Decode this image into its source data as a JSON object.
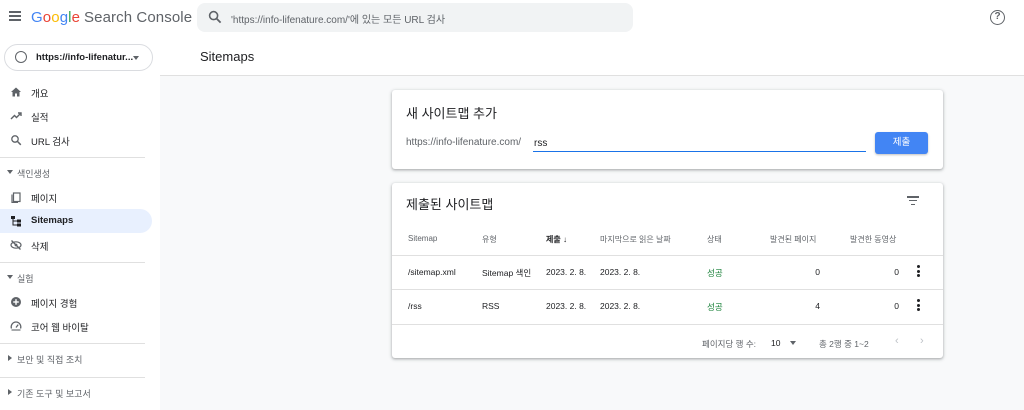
{
  "brand": {
    "google": "Google",
    "product": "Search Console"
  },
  "search": {
    "placeholder": "'https://info-lifenature.com/'에 있는 모든 URL 검사"
  },
  "property": {
    "label": "https://info-lifenatur..."
  },
  "sidebar": {
    "items_top": [
      {
        "label": "개요",
        "icon": "home-icon"
      },
      {
        "label": "실적",
        "icon": "trending-up-icon"
      },
      {
        "label": "URL 검사",
        "icon": "search-icon"
      }
    ],
    "section_indexing": "색인생성",
    "items_indexing": [
      {
        "label": "페이지",
        "icon": "pages-icon"
      },
      {
        "label": "Sitemaps",
        "icon": "sitemap-icon",
        "active": true
      },
      {
        "label": "삭제",
        "icon": "visibility-off-icon"
      }
    ],
    "section_experience": "실험",
    "items_experience": [
      {
        "label": "페이지 경험",
        "icon": "add-circle-icon"
      },
      {
        "label": "코어 웹 바이탈",
        "icon": "speed-icon"
      }
    ],
    "section_security": "보안 및 직접 조치",
    "section_legacy": "기존 도구 및 보고서"
  },
  "page": {
    "title": "Sitemaps"
  },
  "add_card": {
    "title": "새 사이트맵 추가",
    "url_prefix": "https://info-lifenature.com/",
    "input_value": "rss",
    "submit_label": "제출"
  },
  "submitted_card": {
    "title": "제출된 사이트맵",
    "columns": [
      "Sitemap",
      "유형",
      "제출",
      "마지막으로 읽은 날짜",
      "상태",
      "발견된 페이지",
      "발견한 동영상"
    ],
    "rows": [
      {
        "sitemap": "/sitemap.xml",
        "type": "Sitemap 색인",
        "submitted": "2023. 2. 8.",
        "last_read": "2023. 2. 8.",
        "status": "성공",
        "pages": "0",
        "videos": "0"
      },
      {
        "sitemap": "/rss",
        "type": "RSS",
        "submitted": "2023. 2. 8.",
        "last_read": "2023. 2. 8.",
        "status": "성공",
        "pages": "4",
        "videos": "0"
      }
    ],
    "footer": {
      "rows_per_page_label": "페이지당 행 수:",
      "rows_per_page": "10",
      "count": "총 2행 중 1~2"
    }
  },
  "colors": {
    "accent": "#1a73e8",
    "button": "#4285f4",
    "success": "#188038",
    "active_nav": "#e8f0fe"
  }
}
